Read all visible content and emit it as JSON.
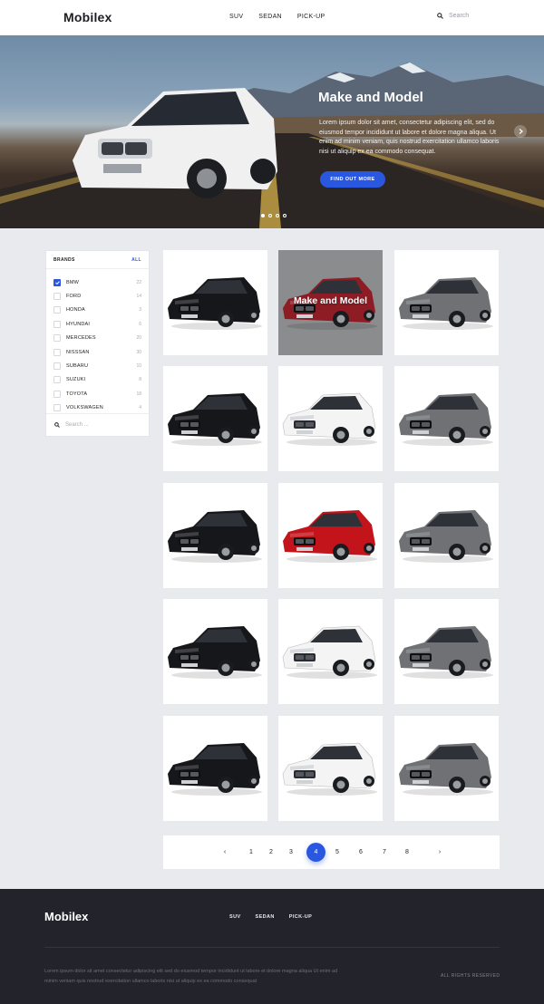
{
  "header": {
    "logo": "Mobilex",
    "nav": [
      "SUV",
      "SEDAN",
      "PICK-UP"
    ],
    "search_placeholder": "Search"
  },
  "hero": {
    "title": "Make and Model",
    "text": "Lorem ipsum dolor sit amet, consectetur adipiscing elit, sed do eiusmod tempor incididunt ut labore et dolore magna aliqua. Ut enim ad minim veniam, quis nostrud exercitation ullamco laboris nisi ut aliquip ex ea commodo consequat.",
    "button": "FIND OUT MORE",
    "slide_count": 4,
    "active_slide": 1
  },
  "filter": {
    "title": "BRANDS",
    "all_label": "ALL",
    "brands": [
      {
        "name": "BMW",
        "count": "22",
        "checked": true
      },
      {
        "name": "FORD",
        "count": "14",
        "checked": false
      },
      {
        "name": "HONDA",
        "count": "3",
        "checked": false
      },
      {
        "name": "HYUNDAI",
        "count": "6",
        "checked": false
      },
      {
        "name": "MERCEDES",
        "count": "20",
        "checked": false
      },
      {
        "name": "NISSSAN",
        "count": "30",
        "checked": false
      },
      {
        "name": "SUBARU",
        "count": "10",
        "checked": false
      },
      {
        "name": "SUZUKI",
        "count": "8",
        "checked": false
      },
      {
        "name": "TOYOTA",
        "count": "18",
        "checked": false
      },
      {
        "name": "VOLKSWAGEN",
        "count": "4",
        "checked": false
      }
    ],
    "search_placeholder": "Search ..."
  },
  "grid": {
    "hover_title": "Make and Model",
    "hover_index": 1,
    "car_colors": [
      "#16171a",
      "#8e1c24",
      "#6f7174",
      "#16171a",
      "#f4f4f4",
      "#6f7174",
      "#16171a",
      "#c4141b",
      "#6f7174",
      "#16171a",
      "#f4f4f4",
      "#6f7174",
      "#16171a",
      "#f4f4f4",
      "#6f7174"
    ]
  },
  "pagination": {
    "prev": "‹",
    "next": "›",
    "pages": [
      "1",
      "2",
      "3",
      "4",
      "5",
      "6",
      "7",
      "8"
    ],
    "current": "4"
  },
  "footer": {
    "logo": "Mobilex",
    "nav": [
      "SUV",
      "SEDAN",
      "PICK-UP"
    ],
    "text": "Lorem ipsum dolor sit amet consectetur adipiscing elit sed do eiusmod tempor incididunt ut labore et dolore magna aliqua Ut enim ad minim veniam quis nostrud exercitation ullamco laboris nisi ut aliquip ex ea commodo consequat",
    "rights": "ALL RIGHTS RESERVED"
  },
  "colors": {
    "accent": "#2a57e0",
    "footer_bg": "#23242b",
    "page_bg": "#e9eaee"
  },
  "icons": [
    "search-icon",
    "chevron-right-icon",
    "chevron-left-icon",
    "check-icon",
    "car-image"
  ]
}
